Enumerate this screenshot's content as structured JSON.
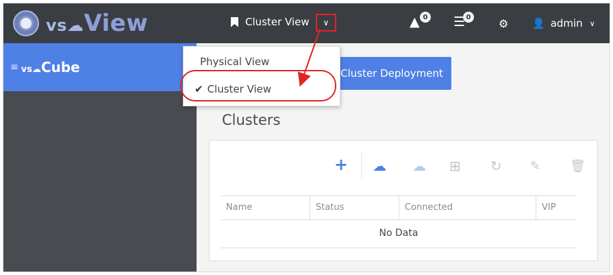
{
  "topbar": {
    "brand_prefix": "vs",
    "brand_name": "View",
    "view_label": "Cluster View",
    "alerts_count": "0",
    "tasks_count": "0",
    "user": "admin"
  },
  "dropdown": {
    "items": [
      {
        "label": "Physical View",
        "selected": false
      },
      {
        "label": "Cluster View",
        "selected": true
      }
    ]
  },
  "sidebar": {
    "brand_prefix": "vs",
    "brand_name": "Cube"
  },
  "main": {
    "deploy_button": "Cluster Deployment",
    "section_title": "Clusters",
    "columns": [
      "Name",
      "Status",
      "Connected",
      "VIP"
    ],
    "empty_text": "No Data"
  },
  "colors": {
    "accent": "#4f80e6",
    "topbar": "#3a3e43",
    "sidebar": "#484b50",
    "highlight": "#e02424"
  }
}
